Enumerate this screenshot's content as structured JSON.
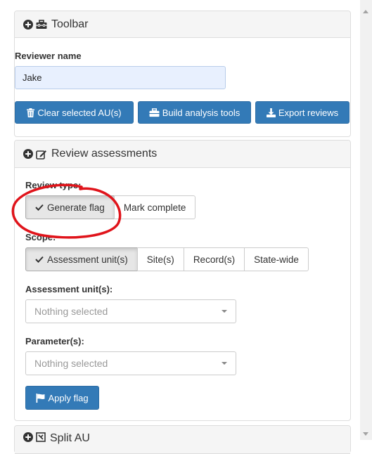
{
  "toolbar_panel": {
    "title": "Toolbar",
    "reviewer_label": "Reviewer name",
    "reviewer_value": "Jake",
    "buttons": {
      "clear": "Clear selected AU(s)",
      "build": "Build analysis tools",
      "export": "Export reviews"
    }
  },
  "review_panel": {
    "title": "Review assessments",
    "review_type_label": "Review type:",
    "review_type_options": [
      "Generate flag",
      "Mark complete"
    ],
    "review_type_selected": "Generate flag",
    "scope_label": "Scope:",
    "scope_options": [
      "Assessment unit(s)",
      "Site(s)",
      "Record(s)",
      "State-wide"
    ],
    "scope_selected": "Assessment unit(s)",
    "au_label": "Assessment unit(s):",
    "au_placeholder": "Nothing selected",
    "param_label": "Parameter(s):",
    "param_placeholder": "Nothing selected",
    "apply_button": "Apply flag"
  },
  "split_panel": {
    "title": "Split AU"
  },
  "colors": {
    "primary": "#337ab7",
    "annotation": "#e0141b",
    "heading_bg": "#f5f5f5"
  },
  "icons": [
    "plus-circle-icon",
    "toolbox-icon",
    "edit-icon",
    "trash-icon",
    "download-icon",
    "check-icon",
    "flag-icon"
  ]
}
